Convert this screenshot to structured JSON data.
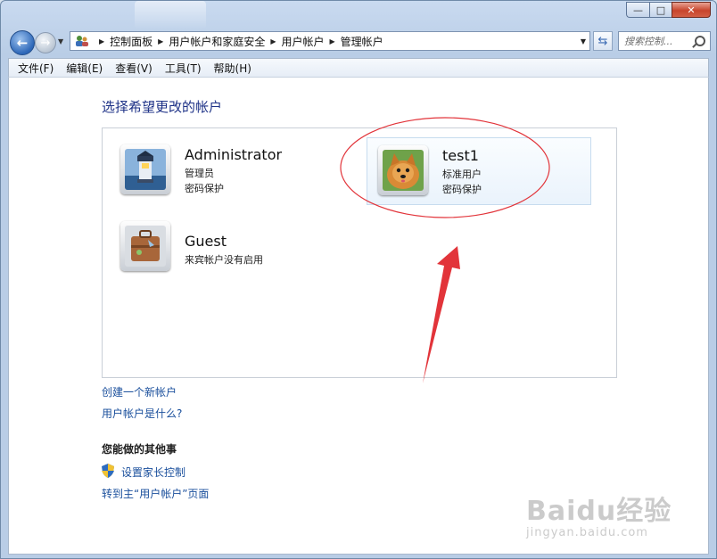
{
  "window": {
    "buttons": {
      "minimize": "—",
      "maximize": "□",
      "close": "✕"
    }
  },
  "nav": {
    "back_icon": "back-arrow-icon",
    "forward_icon": "forward-arrow-icon",
    "breadcrumbs": [
      "控制面板",
      "用户帐户和家庭安全",
      "用户帐户",
      "管理帐户"
    ],
    "search_placeholder": "搜索控制..."
  },
  "menu": {
    "items": [
      "文件(F)",
      "编辑(E)",
      "查看(V)",
      "工具(T)",
      "帮助(H)"
    ]
  },
  "main": {
    "heading": "选择希望更改的帐户",
    "accounts": [
      {
        "name": "Administrator",
        "line1": "管理员",
        "line2": "密码保护",
        "icon": "lighthouse-icon"
      },
      {
        "name": "test1",
        "line1": "标准用户",
        "line2": "密码保护",
        "icon": "puppy-icon",
        "selected": true
      },
      {
        "name": "Guest",
        "line1": "来宾帐户没有启用",
        "line2": "",
        "icon": "suitcase-icon"
      }
    ],
    "links": {
      "create": "创建一个新帐户",
      "what_is": "用户帐户是什么?"
    },
    "other_section": {
      "title": "您能做的其他事",
      "parental": "设置家长控制",
      "goto_main": "转到主“用户帐户”页面"
    }
  },
  "watermark": {
    "main": "Baidu经验",
    "sub": "jingyan.baidu.com"
  },
  "colors": {
    "link": "#1a4f9c",
    "heading": "#1e3287",
    "annotation": "#e2343a"
  }
}
